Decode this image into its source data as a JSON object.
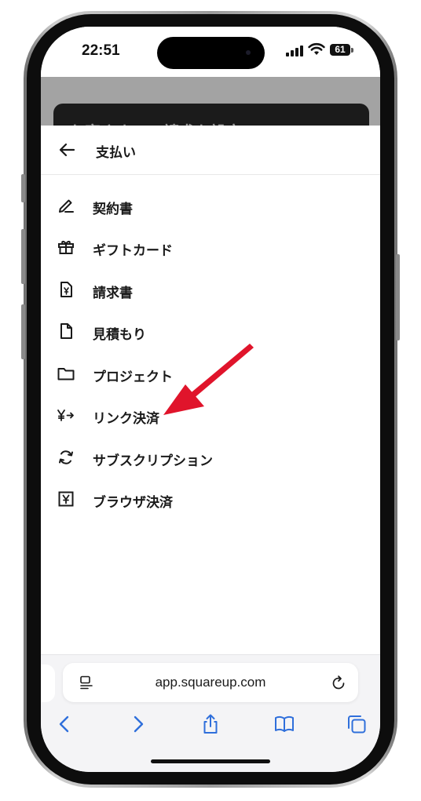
{
  "status_bar": {
    "time": "22:51",
    "battery": "61"
  },
  "background_page": {
    "heading": "お客さまへの請求を設定"
  },
  "sheet": {
    "title": "支払い",
    "items": [
      {
        "label": "契約書",
        "icon": "pencil-icon"
      },
      {
        "label": "ギフトカード",
        "icon": "gift-icon"
      },
      {
        "label": "請求書",
        "icon": "invoice-yen-icon"
      },
      {
        "label": "見積もり",
        "icon": "document-icon"
      },
      {
        "label": "プロジェクト",
        "icon": "folder-icon"
      },
      {
        "label": "リンク決済",
        "icon": "yen-arrow-icon"
      },
      {
        "label": "サブスクリプション",
        "icon": "refresh-cycle-icon"
      },
      {
        "label": "ブラウザ決済",
        "icon": "yen-box-icon"
      }
    ]
  },
  "browser": {
    "url": "app.squareup.com"
  },
  "colors": {
    "accent_blue": "#2f6fdb",
    "annotation_red": "#e0142b",
    "text": "#1a1a1a"
  }
}
